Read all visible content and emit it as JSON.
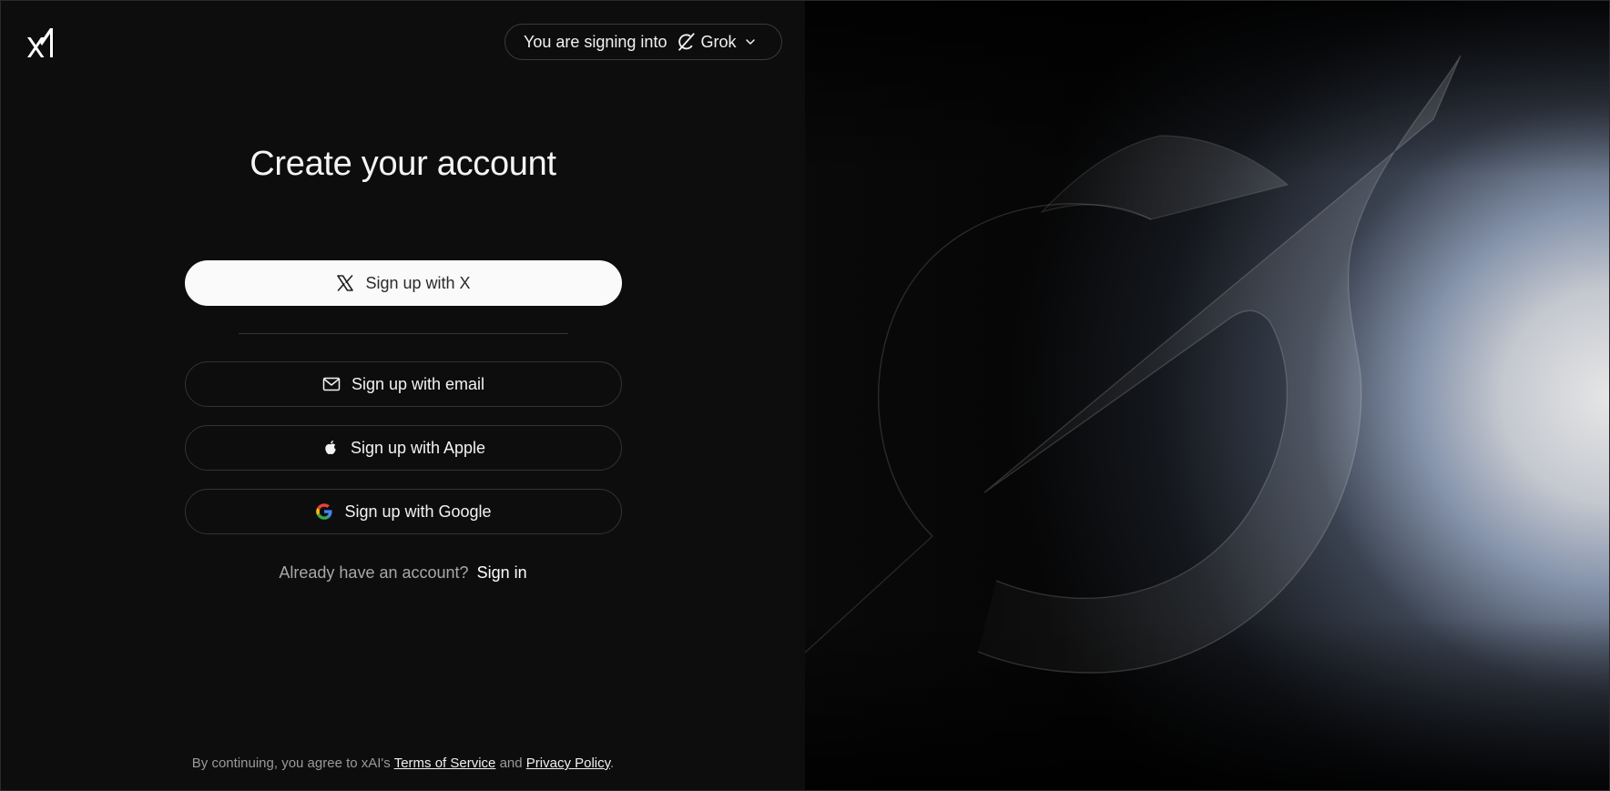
{
  "header": {
    "logo_icon": "xai-logo-icon",
    "selector_prefix": "You are signing into",
    "selector_app": "Grok",
    "selector_icon": "grok-icon",
    "chevron_icon": "chevron-down-icon"
  },
  "main": {
    "title": "Create your account",
    "buttons": {
      "x": "Sign up with X",
      "email": "Sign up with email",
      "apple": "Sign up with Apple",
      "google": "Sign up with Google"
    },
    "already_text": "Already have an account?",
    "signin_link": "Sign in"
  },
  "footer": {
    "prefix": "By continuing, you agree to xAI's",
    "terms": "Terms of Service",
    "and": "and",
    "privacy": "Privacy Policy",
    "suffix": "."
  },
  "colors": {
    "left_bg": "#0d0d0d",
    "primary_button_bg": "#fafafa",
    "text": "#f2f2f2",
    "muted_text": "#a8a8a8",
    "border": "#333333"
  }
}
